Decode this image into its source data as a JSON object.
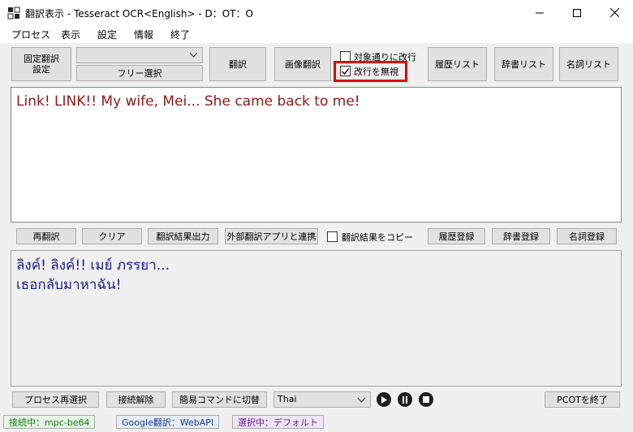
{
  "window": {
    "title": "翻訳表示 - Tesseract OCR<English> - D：ОT：О"
  },
  "menu": [
    "プロセス",
    "表示",
    "設定",
    "情報",
    "終了"
  ],
  "toolbar": {
    "fixed_translation_settings": "固定翻訳\n設定",
    "combo_value": "",
    "free_select": "フリー選択",
    "translate": "翻訳",
    "image_translate": "画像翻訳",
    "line_break_per_target": "対象通りに改行",
    "ignore_line_breaks": "改行を無視",
    "history_list": "履歴リスト",
    "dictionary_list": "辞書リスト",
    "noun_list": "名詞リスト"
  },
  "source_text": "Link! LINK!! My wife, Mei... She came back to me!",
  "actions": {
    "retranslate": "再翻訳",
    "clear": "クリア",
    "output_result": "翻訳結果出力",
    "external_app": "外部翻訳アプリと連携",
    "copy_result": "翻訳結果をコピー",
    "register_history": "履歴登録",
    "register_dictionary": "辞書登録",
    "register_noun": "名詞登録"
  },
  "translated_text": "ลิงค์! ลิงค์!! เมย์ ภรรยา...\nเธอกลับมาหาฉัน!",
  "bottom": {
    "reselect_process": "プロセス再選択",
    "disconnect": "接続解除",
    "simple_command": "簡易コマンドに切替",
    "language": "Thai",
    "exit_pcot": "PCOTを終了"
  },
  "status": {
    "connected": "接続中：mpc-be64",
    "google": "Google翻訳：WebAPI",
    "selected": "選択中：デフォルト"
  },
  "colors": {
    "source_text": "#8b1a1a",
    "translated_text": "#1a1a8b",
    "highlight": "#e00000"
  }
}
